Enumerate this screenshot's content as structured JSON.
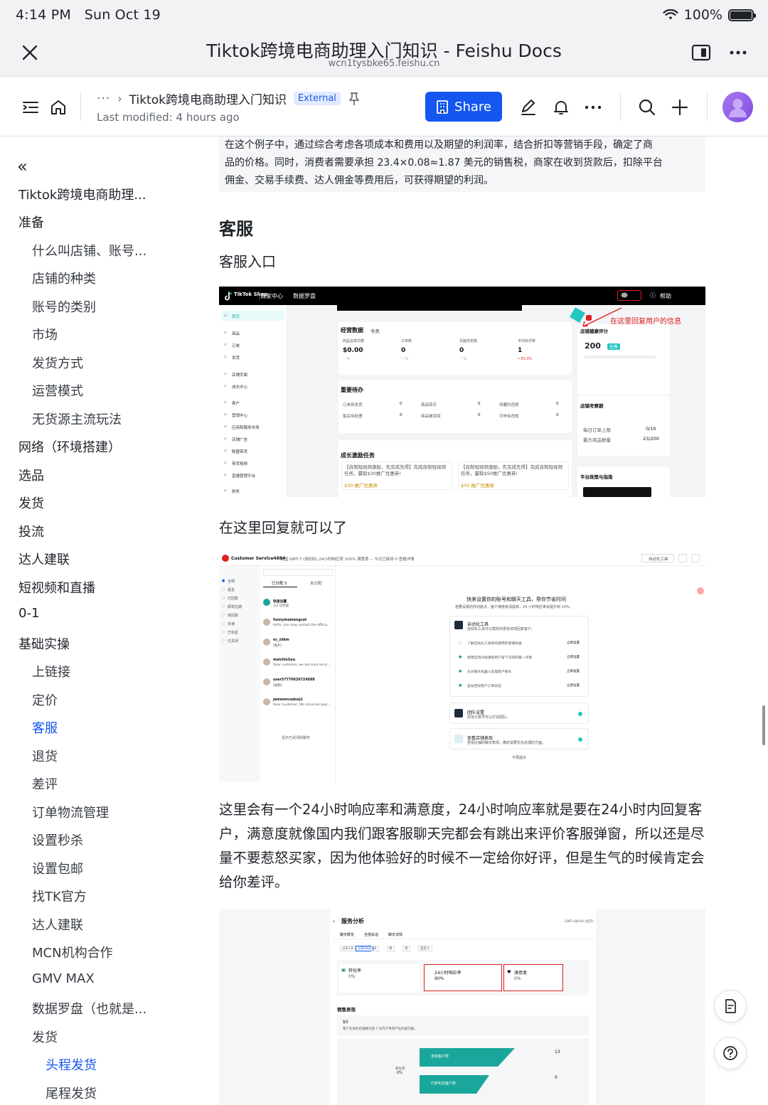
{
  "status_bar": {
    "time": "4:14 PM",
    "date": "Sun Oct 19",
    "battery": "100%"
  },
  "window": {
    "title": "Tiktok跨境电商助理入门知识 - Feishu Docs",
    "url": "wcn1tysbke65.feishu.cn"
  },
  "doc_toolbar": {
    "breadcrumb_ellipsis": "···",
    "doc_title": "Tiktok跨境电商助理入门知识",
    "external_badge": "External",
    "last_modified": "Last modified: 4 hours ago",
    "share_label": "Share"
  },
  "sidebar": {
    "root": "Tiktok跨境电商助理...",
    "items": [
      {
        "label": "准备",
        "level": 1
      },
      {
        "label": "什么叫店铺、账号...",
        "level": 2
      },
      {
        "label": "店铺的种类",
        "level": 2
      },
      {
        "label": "账号的类别",
        "level": 2
      },
      {
        "label": "市场",
        "level": 2
      },
      {
        "label": "发货方式",
        "level": 2
      },
      {
        "label": "运营模式",
        "level": 2
      },
      {
        "label": "无货源主流玩法",
        "level": 2
      },
      {
        "label": "网络（环境搭建）",
        "level": 1
      },
      {
        "label": "选品",
        "level": 1
      },
      {
        "label": "发货",
        "level": 1
      },
      {
        "label": "投流",
        "level": 1
      },
      {
        "label": "达人建联",
        "level": 1
      },
      {
        "label": "短视频和直播",
        "level": 1
      },
      {
        "label": "0-1",
        "level": 1
      },
      {
        "label": "基础实操",
        "level": 1
      },
      {
        "label": "上链接",
        "level": 2
      },
      {
        "label": "定价",
        "level": 2
      },
      {
        "label": "客服",
        "level": 2,
        "active": true
      },
      {
        "label": "退货",
        "level": 2
      },
      {
        "label": "差评",
        "level": 2
      },
      {
        "label": "订单物流管理",
        "level": 2
      },
      {
        "label": "设置秒杀",
        "level": 2
      },
      {
        "label": "设置包邮",
        "level": 2
      },
      {
        "label": "找TK官方",
        "level": 2
      },
      {
        "label": "达人建联",
        "level": 2
      },
      {
        "label": "MCN机构合作",
        "level": 2
      },
      {
        "label": "GMV MAX",
        "level": 2
      },
      {
        "label": "数据罗盘（也就是...",
        "level": 2
      },
      {
        "label": "发货",
        "level": 2
      },
      {
        "label": "头程发货",
        "level": 3,
        "active": true
      },
      {
        "label": "尾程发货",
        "level": 3
      }
    ]
  },
  "content": {
    "callout_lines": [
      "在这个例子中，通过综合考虑各项成本和费用以及期望的利润率，结合折扣等营销手段，确定了商",
      "品的价格。同时，消费者需要承担 23.4×0.08≈1.87 美元的销售税，商家在收到货款后，扣除平台",
      "佣金、交易手续费、达人佣金等费用后，可获得期望的利润。"
    ],
    "heading": "客服",
    "subheading": "客服入口",
    "caption1": "在这里回复就可以了",
    "paragraph": "这里会有一个24小时响应率和满意度，24小时响应率就是要在24小时内回复客户，满意度就像国内我们跟客服聊天完都会有跳出来评价客服弹窗，所以还是尽量不要惹怒买家，因为他体验好的时候不一定给你好评，但是生气的时候肯定会给你差评。"
  },
  "screenshot1": {
    "logo": "TikTok Shop",
    "nav": [
      "商家中心",
      "数据罗盘"
    ],
    "help": "帮助",
    "annotation": "在这里回复用户的信息",
    "side_items": [
      "首页",
      "商品",
      "订单",
      "发货",
      "店铺页面",
      "成长中心",
      "客户",
      "营销中心",
      "应用和服务市场",
      "店铺广告",
      "联盟带货",
      "带货视频",
      "直播管理平台",
      "财务"
    ],
    "business_title": "经营数据",
    "period": "今天",
    "stats": [
      {
        "label": "商品总成交额",
        "value": "$0.00",
        "delta": "-- %"
      },
      {
        "label": "订单数",
        "value": "0",
        "delta": "-- %"
      },
      {
        "label": "页面浏览数",
        "value": "0",
        "delta": "-- %"
      },
      {
        "label": "平均好评率",
        "value": "1",
        "delta": "• 83.3%"
      }
    ],
    "health_title": "店铺健康评分",
    "health_score": "200",
    "health_badge": "优秀",
    "todo_title": "重要待办",
    "todos": [
      {
        "label": "订单待发货",
        "value": "0"
      },
      {
        "label": "商品库存",
        "value": "0"
      },
      {
        "label": "待履约违规",
        "value": "0"
      },
      {
        "label": "售后待处理",
        "value": "0"
      },
      {
        "label": "商品被驳回",
        "value": "0"
      },
      {
        "label": "可申诉违规",
        "value": "0"
      }
    ],
    "assessment_title": "店铺考察期",
    "assessment_rows": [
      {
        "label": "每日订单上限",
        "value": "0/10"
      },
      {
        "label": "最大商品数量",
        "value": "23/200"
      }
    ],
    "growth_title": "成长激励任务",
    "growth_tasks": [
      "【自制短视频激励，先完成先得】完成自制短视频任务，赢取$30推广优惠券!",
      "【自制短视频激励，先完成先得】完成自制短视频任务，赢取$50推广优惠券!"
    ],
    "coupons": [
      "$30 推广优惠券",
      "$50 推广优惠券"
    ],
    "policy_title": "平台政策与指南"
  },
  "screenshot2": {
    "header_title": "Customer Service4884",
    "header_stats": "美国 GMT-7 (洛杉矶)    24小时响应率 100%   满意率 --   今日已接待 0   查看详情",
    "auto_tools": "自动化工具",
    "filters": [
      "全部",
      "紧急",
      "已回复",
      "即将过期",
      "未回复",
      "未读",
      "已标星",
      "已关闭"
    ],
    "tabs": [
      "已分配 5",
      "未分配"
    ],
    "conversations": [
      {
        "name": "快速设置",
        "msg": "3/3 已完成"
      },
      {
        "name": "funnymemengcat",
        "msg": "Hello, you may contact the officia..."
      },
      {
        "name": "oc_zlikm",
        "msg": "[图片]"
      },
      {
        "name": "malchixSeu",
        "msg": "Dear customer, we are truly sorry ..."
      },
      {
        "name": "user57770639724898",
        "msg": "[视频]"
      },
      {
        "name": "jamesmcadooj1",
        "msg": "Dear Customer, We sincerely apol..."
      }
    ],
    "load_more": "显示已关闭的聊天",
    "setup_title": "快来设置你的账号和聊天工具，帮你节省时间",
    "setup_sub": "若要设置的你功能点，客户满意度请提高，24 小时响应率会提升到 10%。",
    "auto_card_title": "自动化工具",
    "auto_card_sub": "自动化工具可以帮助你更有效地回复客户。",
    "auto_steps": [
      "了解自动化工具如何使用的店铺收益",
      "使用自动问候语给用户留下深刻的第一印象",
      "允许聊天机器人处理客户聊天",
      "自动告知客户订单状态"
    ],
    "step_action": "立即设置",
    "team_title": "团队设置",
    "team_sub": "添加子账号可以打造团队。",
    "perf_title": "查看店铺表现",
    "perf_sub": "查看店铺的聊天表现，确定需要优先处理的方面。",
    "dismiss": "不再提示"
  },
  "screenshot3": {
    "title": "服务分析",
    "timezone": "GMT+08:00 (北京)",
    "tabs": [
      "聊天概览",
      "全部会话",
      "聊天详情"
    ],
    "ranges": [
      "过去7天",
      "过去28天",
      "日",
      "周",
      "月",
      "自定义"
    ],
    "metrics": [
      {
        "label": "转化率",
        "value": "0%"
      },
      {
        "label": "24小时响应率",
        "value": "90%"
      },
      {
        "label": "满意度",
        "value": "0%"
      }
    ],
    "sales_title": "销售表现",
    "sales_value": "$0",
    "sales_desc": "客户在你的店铺聊天后 7 天内下单所产生的成交额。",
    "funnel": [
      {
        "label": "咨询客户数",
        "value": "13"
      },
      {
        "label": "已转化的客户数",
        "value": "0"
      }
    ],
    "conversion_label": "转化率",
    "conversion_value": "0%"
  },
  "colors": {
    "accent": "#1456f0",
    "annotation_red": "#e02020",
    "tiktok_teal": "#25c6c4",
    "avatar": "#9e6ff0"
  }
}
